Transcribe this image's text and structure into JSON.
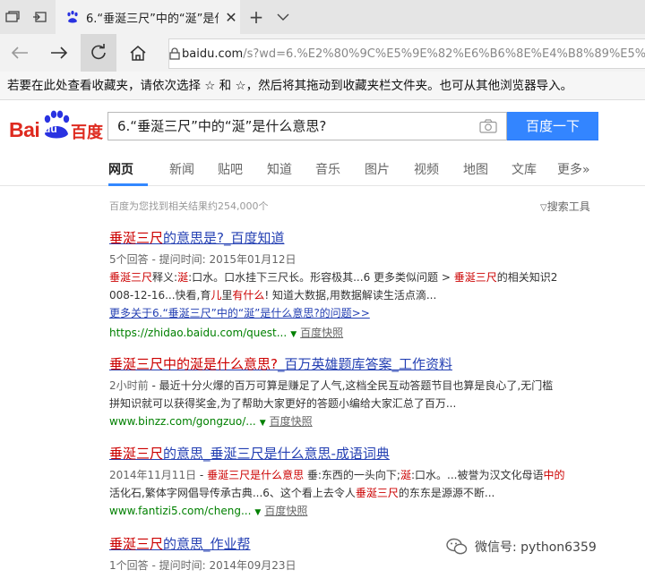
{
  "browser": {
    "tab_title": "6.“垂涎三尺”中的“涎”是什",
    "url_domain": "baidu.com",
    "url_rest": "/s?wd=6.%E2%80%9C%E5%9E%82%E6%B6%8E%E4%B8%89%E5%B0%BA%E5",
    "favorites_hint": "若要在此处查看收藏夹，请依次选择 ☆ 和 ☆，然后将其拖动到收藏夹栏文件夹。也可从其他浏览器导入。"
  },
  "baidu": {
    "logo_text_latin": "Bai",
    "logo_text_du": "du",
    "logo_text_cn": "百度",
    "query": "6.“垂涎三尺”中的“涎”是什么意思?",
    "search_button": "百度一下",
    "tabs": [
      "网页",
      "新闻",
      "贴吧",
      "知道",
      "音乐",
      "图片",
      "视频",
      "地图",
      "文库",
      "更多»"
    ],
    "active_tab": "网页",
    "result_count": "百度为您找到相关结果约254,000个",
    "search_tools": "搜索工具"
  },
  "results": [
    {
      "title_hl": "垂涎三尺",
      "title_rest": "的意思是?_百度知道",
      "meta": "5个回答 - 提问时间: 2015年01月12日",
      "snippet1": "<em>垂涎三尺</em>释义:<em>涎</em>:口水。口水挂下三尺长。形容极其...6 更多类似问题 > <em>垂涎三尺</em>的相关知识2",
      "snippet2": "008-12-16...快看,育<em>儿</em>里<em>有什么</em>! 知道大数据,用数据解读生活点滴...",
      "more_link": "更多关于6.“垂涎三尺”中的“涎”是什么意思?的问题>>",
      "url": "https://zhidao.baidu.com/quest...",
      "snapshot": "百度快照"
    },
    {
      "title_hl": "垂涎三尺中的涎是什么意思?",
      "title_rest": "_百万英雄题库答案_工作资料",
      "snippet1": "<span class=\"gray\">2小时前</span> - 最近十分火爆的百万可算是赚足了人气,这档全民互动答题节目也算是良心了,无门槛",
      "snippet2": "拼知识就可以获得奖金,为了帮助大家更好的答题小编给大家汇总了百万...",
      "url": "www.binzz.com/gongzuo/...",
      "snapshot": "百度快照"
    },
    {
      "title_hl": "垂涎三尺",
      "title_rest": "的意思_垂涎三尺是什么意思-成语词典",
      "snippet1": "<span class=\"gray\">2014年11月11日</span> - <em>垂涎三尺是什么意思</em> 垂:东西的一头向下;<em>涎</em>:口水。...被誉为汉文化母语<em>中的</em>",
      "snippet2": "活化石,繁体字网倡导传承古典...6、这个看上去令人<em>垂涎三尺</em>的东东是源源不断...",
      "url": "www.fantizi5.com/cheng...",
      "snapshot": "百度快照"
    },
    {
      "title_hl": "垂涎三尺",
      "title_rest": "的意思_作业帮",
      "meta": "1个回答 - 提问时间: 2014年09月23日"
    }
  ],
  "watermark": "微信号: python6359"
}
